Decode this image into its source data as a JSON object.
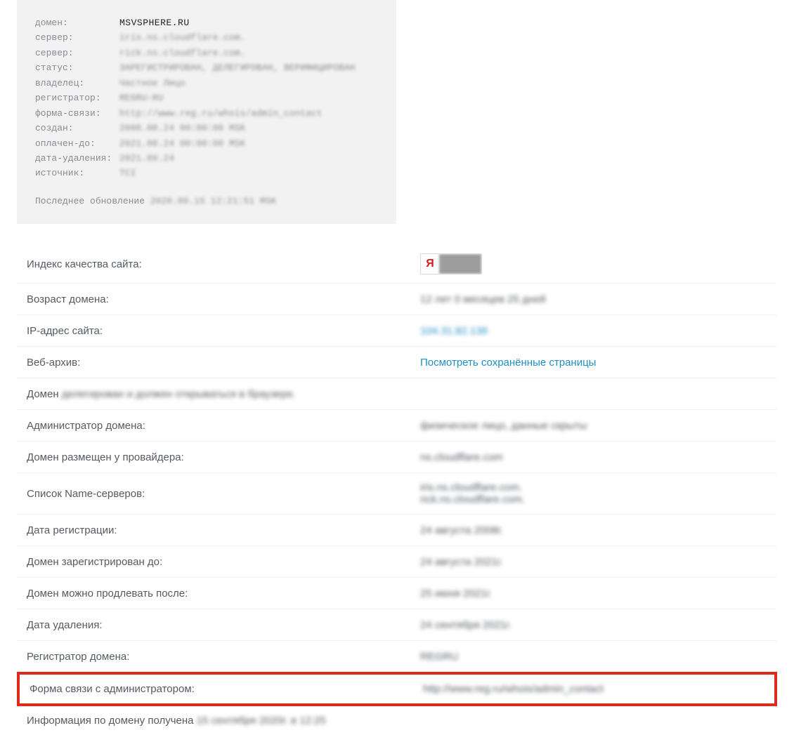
{
  "whois": {
    "rows": [
      {
        "label": "домен:",
        "value": "MSVSPHERE.RU",
        "clear": true
      },
      {
        "label": "сервер:",
        "value": "iris.ns.cloudflare.com."
      },
      {
        "label": "сервер:",
        "value": "rick.ns.cloudflare.com."
      },
      {
        "label": "статус:",
        "value": "ЗАРЕГИСТРИРОВАН, ДЕЛЕГИРОВАН, ВЕРИФИЦИРОВАН"
      },
      {
        "label": "владелец:",
        "value": "Частное Лицо"
      },
      {
        "label": "регистратор:",
        "value": "REGRU-RU"
      },
      {
        "label": "форма-связи:",
        "value": "http://www.reg.ru/whois/admin_contact"
      },
      {
        "label": "создан:",
        "value": "2008.08.24 00:00:00 MSK"
      },
      {
        "label": "оплачен-до:",
        "value": "2021.08.24 00:00:00 MSK"
      },
      {
        "label": "дата-удаления:",
        "value": "2021.09.24"
      },
      {
        "label": "источник:",
        "value": "TCI"
      }
    ],
    "footer_label": "Последнее обновление",
    "footer_value": "2020.09.15 12:21:51 MSK"
  },
  "badge": {
    "logo": "Я"
  },
  "info": {
    "quality_label": "Индекс качества сайта:",
    "age_label": "Возраст домена:",
    "age_value": "12 лет 0 месяцев 25 дней",
    "ip_label": "IP-адрес сайта:",
    "ip_value": "104.31.82.136",
    "archive_label": "Веб-архив:",
    "archive_value": "Посмотреть сохранённые страницы",
    "domain_prefix": "Домен",
    "domain_rest": "делегирован и должен открываться в браузере.",
    "admin_label": "Администратор домена:",
    "admin_value": "физическое лицо, данные скрыты",
    "provider_label": "Домен размещен у провайдера:",
    "provider_value": "ns.cloudflare.com",
    "ns_label": "Список Name-серверов:",
    "ns_value1": "iris.ns.cloudflare.com.",
    "ns_value2": "rick.ns.cloudflare.com.",
    "regdate_label": "Дата регистрации:",
    "regdate_value": "24 августа 2008г.",
    "reguntil_label": "Домен зарегистрирован до:",
    "reguntil_value": "24 августа 2021г.",
    "renew_label": "Домен можно продлевать после:",
    "renew_value": "25 июня 2021г.",
    "delete_label": "Дата удаления:",
    "delete_value": "24 сентября 2021г.",
    "registrar_label": "Регистратор домена:",
    "registrar_value": "REGRU",
    "contact_label": "Форма связи с администратором:",
    "contact_value": "http://www.reg.ru/whois/admin_contact",
    "obtained_prefix": "Информация по домену получена",
    "obtained_value": "15 сентября 2020г. в 12:25"
  }
}
